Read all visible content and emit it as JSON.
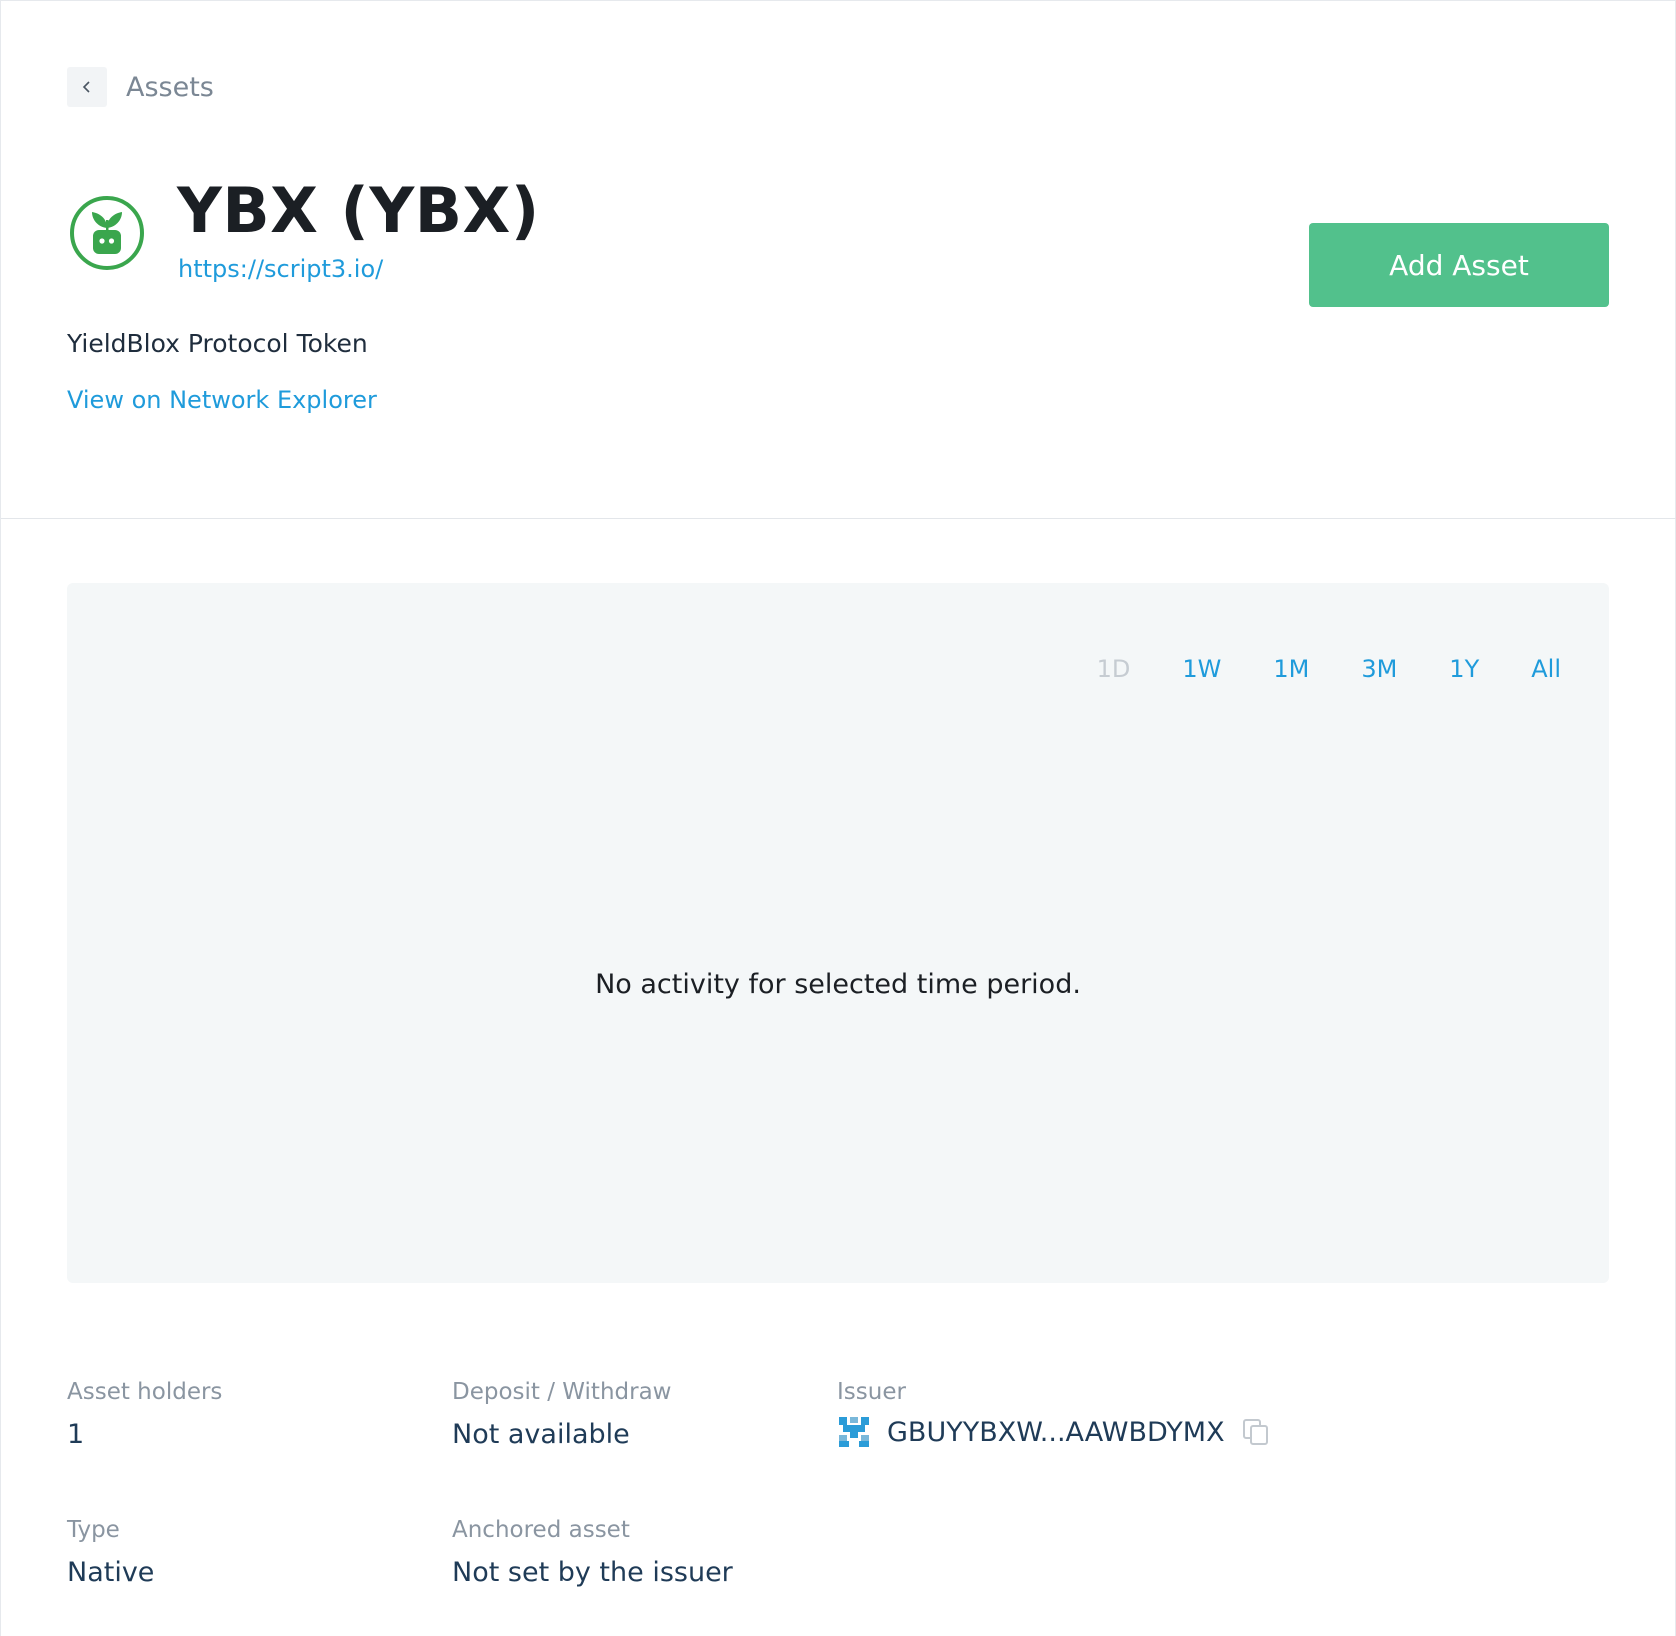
{
  "breadcrumb": {
    "label": "Assets",
    "back_icon": "chevron-left-icon"
  },
  "asset": {
    "title": "YBX (YBX)",
    "url": "https://script3.io/",
    "description": "YieldBlox Protocol Token",
    "explorer_link": "View on Network Explorer",
    "logo_icon": "yieldblox-logo",
    "logo_color": "#3aa64d"
  },
  "actions": {
    "add_asset": "Add Asset",
    "add_asset_color": "#52c18c"
  },
  "chart": {
    "ranges": [
      {
        "label": "1D",
        "disabled": true
      },
      {
        "label": "1W",
        "disabled": false
      },
      {
        "label": "1M",
        "disabled": false
      },
      {
        "label": "3M",
        "disabled": false
      },
      {
        "label": "1Y",
        "disabled": false
      },
      {
        "label": "All",
        "disabled": false
      }
    ],
    "empty_message": "No activity for selected time period."
  },
  "stats": {
    "holders": {
      "label": "Asset holders",
      "value": "1"
    },
    "deposit": {
      "label": "Deposit / Withdraw",
      "value": "Not available"
    },
    "issuer": {
      "label": "Issuer",
      "value": "GBUYYBXW...AAWBDYMX",
      "avatar_icon": "identicon",
      "copy_icon": "copy-icon"
    },
    "type": {
      "label": "Type",
      "value": "Native"
    },
    "anchored": {
      "label": "Anchored asset",
      "value": "Not set by the issuer"
    }
  }
}
